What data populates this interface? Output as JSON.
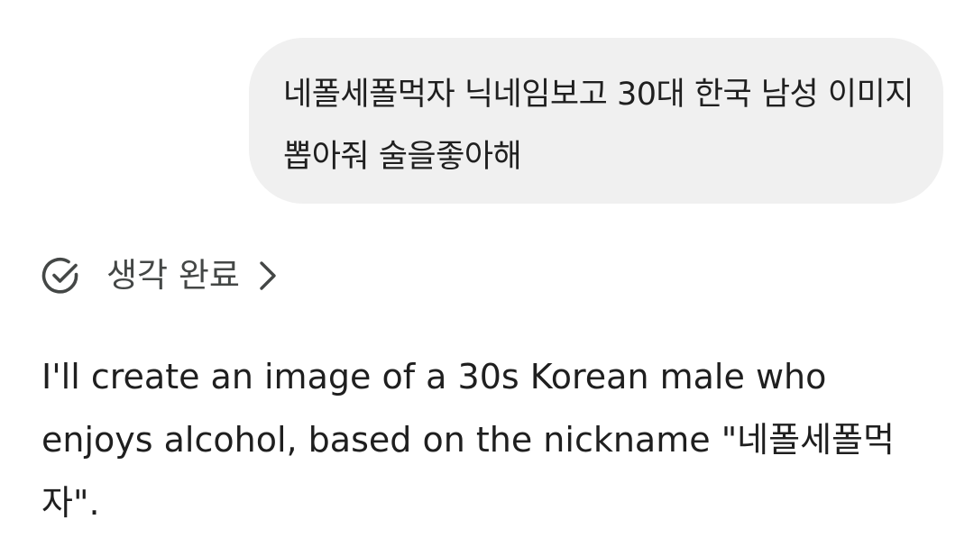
{
  "user_message": {
    "text": "네폴세폴먹자 닉네임보고 30대 한국 남성 이미지 뽑아줘 술을좋아해"
  },
  "thinking": {
    "label": "생각 완료",
    "status_icon": "check-circle-icon",
    "expand_icon": "chevron-right-icon"
  },
  "response": {
    "text": "I'll create an image of a 30s Korean male who enjoys alcohol, based on the nickname \"네폴세폴먹자\"."
  },
  "colors": {
    "bubble_bg": "#f0f0f0",
    "text": "#1f1f1f",
    "muted": "#444746"
  }
}
